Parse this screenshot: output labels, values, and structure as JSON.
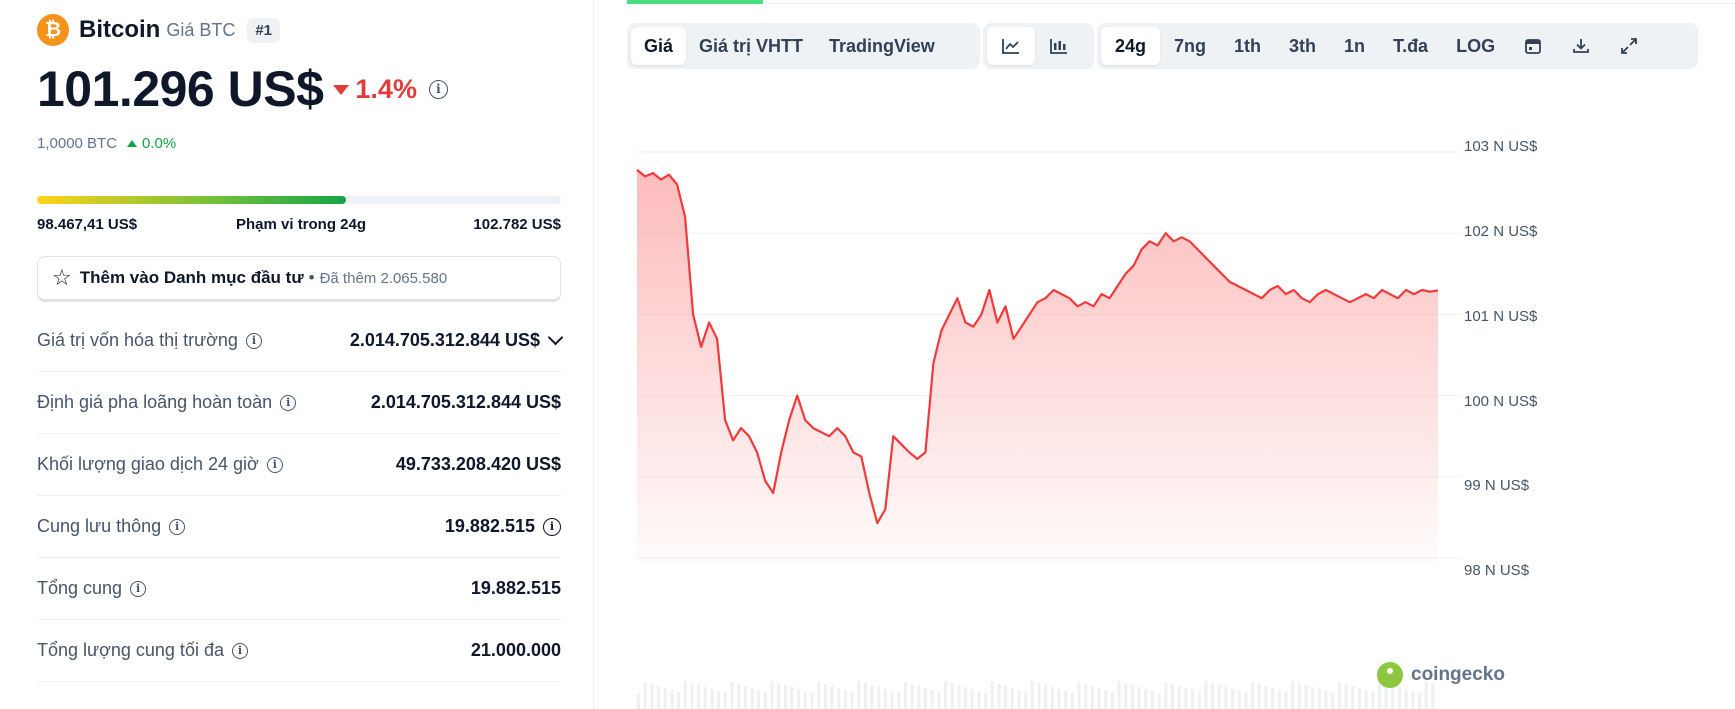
{
  "coin": {
    "logo_glyph": "₿",
    "name": "Bitcoin",
    "subtitle": "Giá BTC",
    "rank": "#1",
    "price": "101.296 US$",
    "change": "1.4%",
    "btc_amount": "1,0000 BTC",
    "btc_change": "0.0%"
  },
  "range": {
    "low": "98.467,41 US$",
    "label": "Phạm vi trong 24g",
    "high": "102.782 US$",
    "fill_fraction": 0.59
  },
  "watchlist": {
    "label": "Thêm vào Danh mục đầu tư",
    "sep": "•",
    "added": "Đã thêm 2.065.580"
  },
  "stats": [
    {
      "label": "Giá trị vốn hóa thị trường",
      "value": "2.014.705.312.844 US$"
    },
    {
      "label": "Định giá pha loãng hoàn toàn",
      "value": "2.014.705.312.844 US$"
    },
    {
      "label": "Khối lượng giao dịch 24 giờ",
      "value": "49.733.208.420 US$"
    },
    {
      "label": "Cung lưu thông",
      "value": "19.882.515"
    },
    {
      "label": "Tổng cung",
      "value": "19.882.515"
    },
    {
      "label": "Tổng lượng cung tối đa",
      "value": "21.000.000"
    }
  ],
  "toolbar": {
    "view_tabs": [
      "Giá",
      "Giá trị VHTT",
      "TradingView"
    ],
    "time_tabs": [
      "24g",
      "7ng",
      "1th",
      "3th",
      "1n",
      "T.đa",
      "LOG"
    ],
    "active_view": "Giá",
    "active_time": "24g",
    "icons": [
      "line-chart-icon",
      "candlestick-icon",
      "calendar-icon",
      "download-icon",
      "expand-icon"
    ]
  },
  "colors": {
    "line": "#ef3b3b",
    "fill_top": "#fca5a5",
    "up": "#16a34a",
    "down": "#e23b3b",
    "grid": "#eef0f3"
  },
  "chart_data": {
    "type": "area",
    "y_tick_labels": [
      "103 N US$",
      "102 N US$",
      "101 N US$",
      "100 N US$",
      "99 N US$",
      "98 N US$"
    ],
    "ylim": [
      98000,
      103000
    ],
    "grid": true,
    "watermark": "coingecko",
    "x": [
      0,
      1,
      2,
      3,
      4,
      5,
      6,
      7,
      8,
      9,
      10,
      11,
      12,
      13,
      14,
      15,
      16,
      17,
      18,
      19,
      20,
      21,
      22,
      23,
      24,
      25,
      26,
      27,
      28,
      29,
      30,
      31,
      32,
      33,
      34,
      35,
      36,
      37,
      38,
      39,
      40,
      41,
      42,
      43,
      44,
      45,
      46,
      47,
      48,
      49,
      50,
      51,
      52,
      53,
      54,
      55,
      56,
      57,
      58,
      59,
      60,
      61,
      62,
      63,
      64,
      65,
      66,
      67,
      68,
      69,
      70,
      71,
      72,
      73,
      74,
      75,
      76,
      77,
      78,
      79,
      80,
      81,
      82,
      83,
      84,
      85,
      86,
      87,
      88,
      89,
      90,
      91,
      92,
      93,
      94,
      95,
      96,
      97,
      98,
      99,
      100
    ],
    "values": [
      102780,
      102700,
      102740,
      102660,
      102720,
      102600,
      102200,
      101000,
      100600,
      100900,
      100700,
      99700,
      99450,
      99600,
      99500,
      99300,
      98950,
      98800,
      99300,
      99700,
      100000,
      99700,
      99600,
      99550,
      99500,
      99600,
      99500,
      99300,
      99250,
      98800,
      98430,
      98600,
      99500,
      99400,
      99300,
      99220,
      99300,
      100400,
      100800,
      101000,
      101200,
      100900,
      100850,
      101000,
      101300,
      100900,
      101100,
      100700,
      100850,
      101000,
      101150,
      101200,
      101300,
      101250,
      101200,
      101100,
      101150,
      101100,
      101250,
      101200,
      101350,
      101500,
      101600,
      101800,
      101900,
      101850,
      102000,
      101900,
      101950,
      101900,
      101800,
      101700,
      101600,
      101500,
      101400,
      101350,
      101300,
      101250,
      101200,
      101300,
      101350,
      101250,
      101300,
      101200,
      101150,
      101250,
      101300,
      101250,
      101200,
      101150,
      101200,
      101250,
      101200,
      101300,
      101250,
      101200,
      101300,
      101250,
      101300,
      101280,
      101296
    ]
  }
}
